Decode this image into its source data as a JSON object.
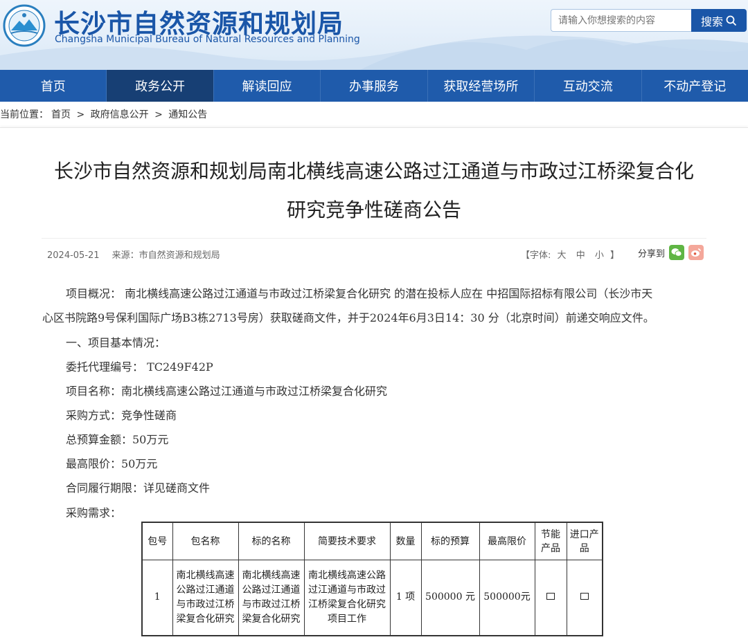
{
  "header": {
    "title_cn": "长沙市自然资源和规划局",
    "title_en": "Changsha Municipal Bureau of Natural Resources and Planning",
    "search_placeholder": "请输入你想搜索的内容",
    "search_button": "搜索"
  },
  "nav": [
    "首页",
    "政务公开",
    "解读回应",
    "办事服务",
    "获取经营场所",
    "互动交流",
    "不动产登记"
  ],
  "breadcrumb": {
    "prefix": "当前位置：",
    "items": [
      "首页",
      ">",
      "政府信息公开",
      ">",
      "通知公告"
    ]
  },
  "article": {
    "title_line1": "长沙市自然资源和规划局南北横线高速公路过江通道与市政过江桥梁复合化",
    "title_line2": "研究竞争性磋商公告",
    "date": "2024-05-21",
    "source": "来源：市自然资源和规划局",
    "font_label": "【字体:",
    "font_big": "大",
    "font_mid": "中",
    "font_small": "小",
    "font_end": "】",
    "share_label": "分享到",
    "paragraphs": [
      "项目概况：  南北横线高速公路过江通道与市政过江桥梁复合化研究  的潜在投标人应在  中招国际招标有限公司（长沙市天",
      "心区书院路9号保利国际广场B3栋2713号房）获取磋商文件，并于2024年6月3日14：30  分（北京时间）前递交响应文件。",
      "一、项目基本情况：",
      "委托代理编号：  TC249F42P",
      "项目名称：南北横线高速公路过江通道与市政过江桥梁复合化研究",
      "采购方式：竞争性磋商",
      "总预算金额：50万元",
      "最高限价：50万元",
      "合同履行期限：详见磋商文件",
      "采购需求："
    ]
  },
  "table": {
    "headers": [
      "包号",
      "包名称",
      "标的名称",
      "简要技术要求",
      "数量",
      "标的预算",
      "最高限价",
      "节能产品",
      "进口产品"
    ],
    "row": {
      "pkg_no": "1",
      "pkg_name": "南北横线高速公路过江通道与市政过江桥梁复合化研究",
      "item_name": "南北横线高速公路过江通道与市政过江桥梁复合化研究",
      "tech_req": "南北横线高速公路过江通道与市政过江桥梁复合化研究项目工作",
      "qty": "1 项",
      "budget": "500000 元",
      "max_price": "500000元"
    }
  },
  "colors": {
    "brand": "#1a56a8",
    "nav": "#1f5bab",
    "nav_active": "#173f74"
  }
}
